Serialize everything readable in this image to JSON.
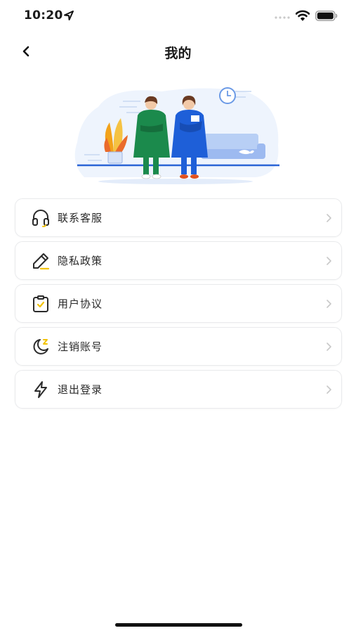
{
  "status_bar": {
    "time": "10:20",
    "icons": [
      "location-arrow-icon",
      "cellular-signal-icon",
      "wifi-icon",
      "battery-icon"
    ]
  },
  "nav": {
    "title": "我的",
    "back_icon": "chevron-left-icon"
  },
  "illustration": {
    "subject": "two-people-standing-illustration"
  },
  "menu": {
    "items": [
      {
        "label": "联系客服",
        "icon": "headset-icon"
      },
      {
        "label": "隐私政策",
        "icon": "pen-icon"
      },
      {
        "label": "用户协议",
        "icon": "clipboard-check-icon"
      },
      {
        "label": "注销账号",
        "icon": "moon-sleep-icon"
      },
      {
        "label": "退出登录",
        "icon": "lightning-icon"
      }
    ],
    "chevron_icon": "chevron-right-icon"
  },
  "colors": {
    "accent": "#f2c200",
    "icon_stroke": "#2b2b2b",
    "border": "#e9eaec",
    "chevron": "#c8c8c8",
    "illustration_blue": "#1e5fd8",
    "illustration_green": "#1b8a4c"
  }
}
